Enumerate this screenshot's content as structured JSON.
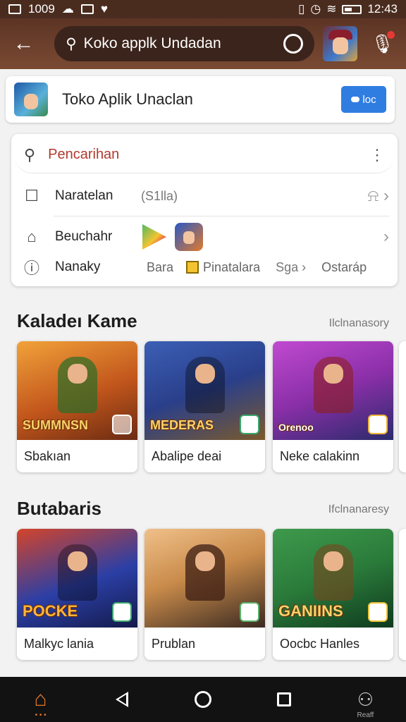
{
  "status_bar": {
    "left_text": "1009",
    "time": "12:43"
  },
  "app_bar": {
    "search_text": "Koko applk Undadan"
  },
  "header": {
    "title": "Toko Aplik Unaclan",
    "button_label": "loc"
  },
  "menu": {
    "search_placeholder": "Pencarihan",
    "row1_label": "Naratelan",
    "row1_sub": "(S1lla)",
    "row2_label": "Beuchahr",
    "row3_label": "Nanaky",
    "row3_item_a": "Bara",
    "row3_item_b": "Pinatalara",
    "row3_item_c": "Sga",
    "row3_item_d": "Ostaráp"
  },
  "section1": {
    "title": "Kaladeı Kame",
    "link": "Ilclnanasory",
    "cards": [
      {
        "caption": "Sbakıan",
        "art_text": "SUMMNSN",
        "colors": [
          "#f1a23a",
          "#6a2b12"
        ]
      },
      {
        "caption": "Abalipe deai",
        "art_text": "MEDERAS",
        "colors": [
          "#2a3f8a",
          "#7a5a2c"
        ]
      },
      {
        "caption": "Neke calakinn",
        "art_text": "Orenoo",
        "colors": [
          "#8a2fa8",
          "#2b2b6b"
        ]
      }
    ]
  },
  "section2": {
    "title": "Butabaris",
    "link": "Ifclnanaresy",
    "cards": [
      {
        "caption": "Malkyc lania",
        "art_text": "POCKE",
        "colors": [
          "#2b3fa6",
          "#d4442a"
        ]
      },
      {
        "caption": "Prublan",
        "art_text": "",
        "colors": [
          "#c98b4a",
          "#3a2a22"
        ]
      },
      {
        "caption": "Oocbc Hanles",
        "art_text": "GANIINS",
        "colors": [
          "#2a7a3a",
          "#0f3a1f"
        ]
      }
    ]
  },
  "nav": {
    "profile_small": "Reaff"
  }
}
